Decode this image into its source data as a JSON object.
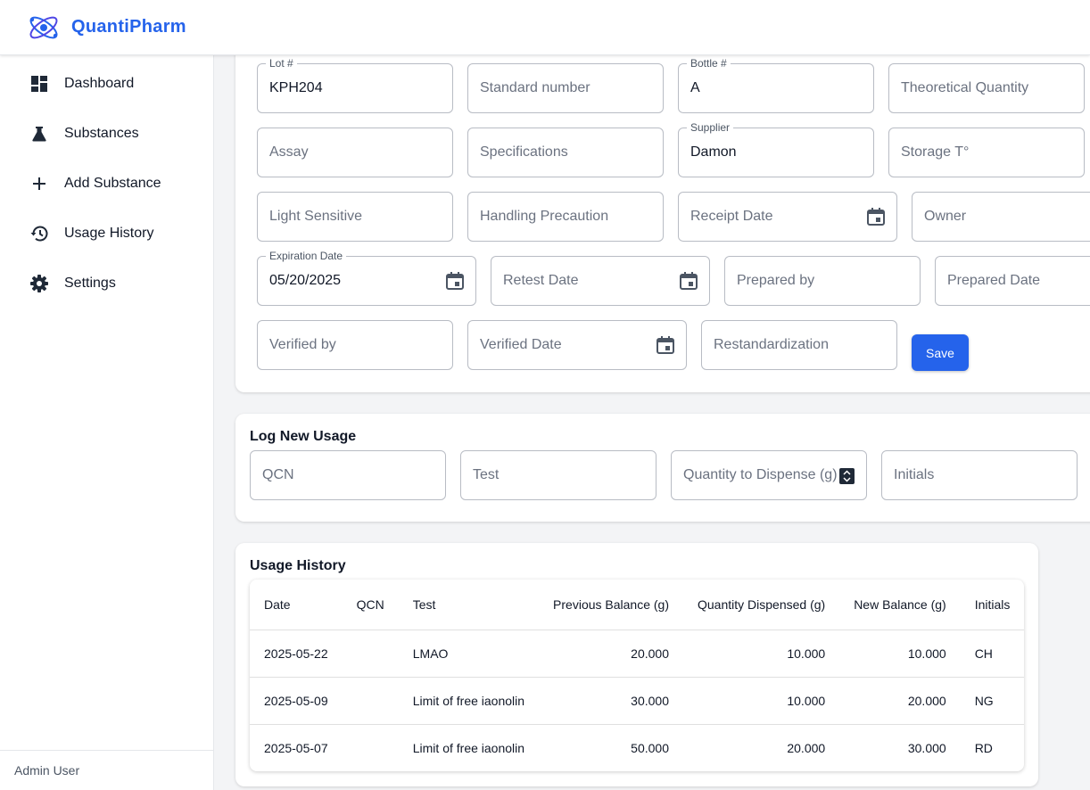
{
  "app": {
    "name": "QuantiPharm"
  },
  "sidebar": {
    "items": [
      {
        "label": "Dashboard",
        "icon": "dashboard-icon"
      },
      {
        "label": "Substances",
        "icon": "flask-icon"
      },
      {
        "label": "Add Substance",
        "icon": "plus-icon"
      },
      {
        "label": "Usage History",
        "icon": "history-icon"
      },
      {
        "label": "Settings",
        "icon": "gear-icon"
      }
    ],
    "footer": "Admin User"
  },
  "form": {
    "lot": {
      "label": "Lot #",
      "value": "KPH204"
    },
    "standard_number": {
      "placeholder": "Standard number"
    },
    "bottle": {
      "label": "Bottle #",
      "value": "A"
    },
    "theoretical_quantity": {
      "placeholder": "Theoretical Quantity"
    },
    "assay": {
      "placeholder": "Assay"
    },
    "specifications": {
      "placeholder": "Specifications"
    },
    "supplier": {
      "label": "Supplier",
      "value": "Damon"
    },
    "storage": {
      "placeholder": "Storage T°"
    },
    "light_sensitive": {
      "placeholder": "Light Sensitive"
    },
    "handling_precaution": {
      "placeholder": "Handling Precaution"
    },
    "receipt_date": {
      "placeholder": "Receipt Date"
    },
    "owner": {
      "placeholder": "Owner"
    },
    "expiration_date": {
      "label": "Expiration Date",
      "value": "05/20/2025"
    },
    "retest_date": {
      "placeholder": "Retest Date"
    },
    "prepared_by": {
      "placeholder": "Prepared by"
    },
    "prepared_date": {
      "placeholder": "Prepared Date"
    },
    "verified_by": {
      "placeholder": "Verified by"
    },
    "verified_date": {
      "placeholder": "Verified Date"
    },
    "restandardization": {
      "placeholder": "Restandardization"
    },
    "save_label": "Save"
  },
  "log_usage": {
    "title": "Log New Usage",
    "qcn": {
      "placeholder": "QCN"
    },
    "test": {
      "placeholder": "Test"
    },
    "quantity": {
      "placeholder": "Quantity to Dispense (g)"
    },
    "initials": {
      "placeholder": "Initials"
    }
  },
  "usage_history": {
    "title": "Usage History",
    "columns": [
      "Date",
      "QCN",
      "Test",
      "Previous Balance (g)",
      "Quantity Dispensed (g)",
      "New Balance (g)",
      "Initials"
    ],
    "rows": [
      {
        "date": "2025-05-22",
        "qcn": "",
        "test": "LMAO",
        "previous": "20.000",
        "dispensed": "10.000",
        "new_balance": "10.000",
        "initials": "CH"
      },
      {
        "date": "2025-05-09",
        "qcn": "",
        "test": "Limit of free iaonolin",
        "previous": "30.000",
        "dispensed": "10.000",
        "new_balance": "20.000",
        "initials": "NG"
      },
      {
        "date": "2025-05-07",
        "qcn": "",
        "test": "Limit of free iaonolin",
        "previous": "50.000",
        "dispensed": "20.000",
        "new_balance": "30.000",
        "initials": "RD"
      }
    ]
  },
  "colors": {
    "accent": "#2563eb",
    "background": "#f3f4f6"
  }
}
